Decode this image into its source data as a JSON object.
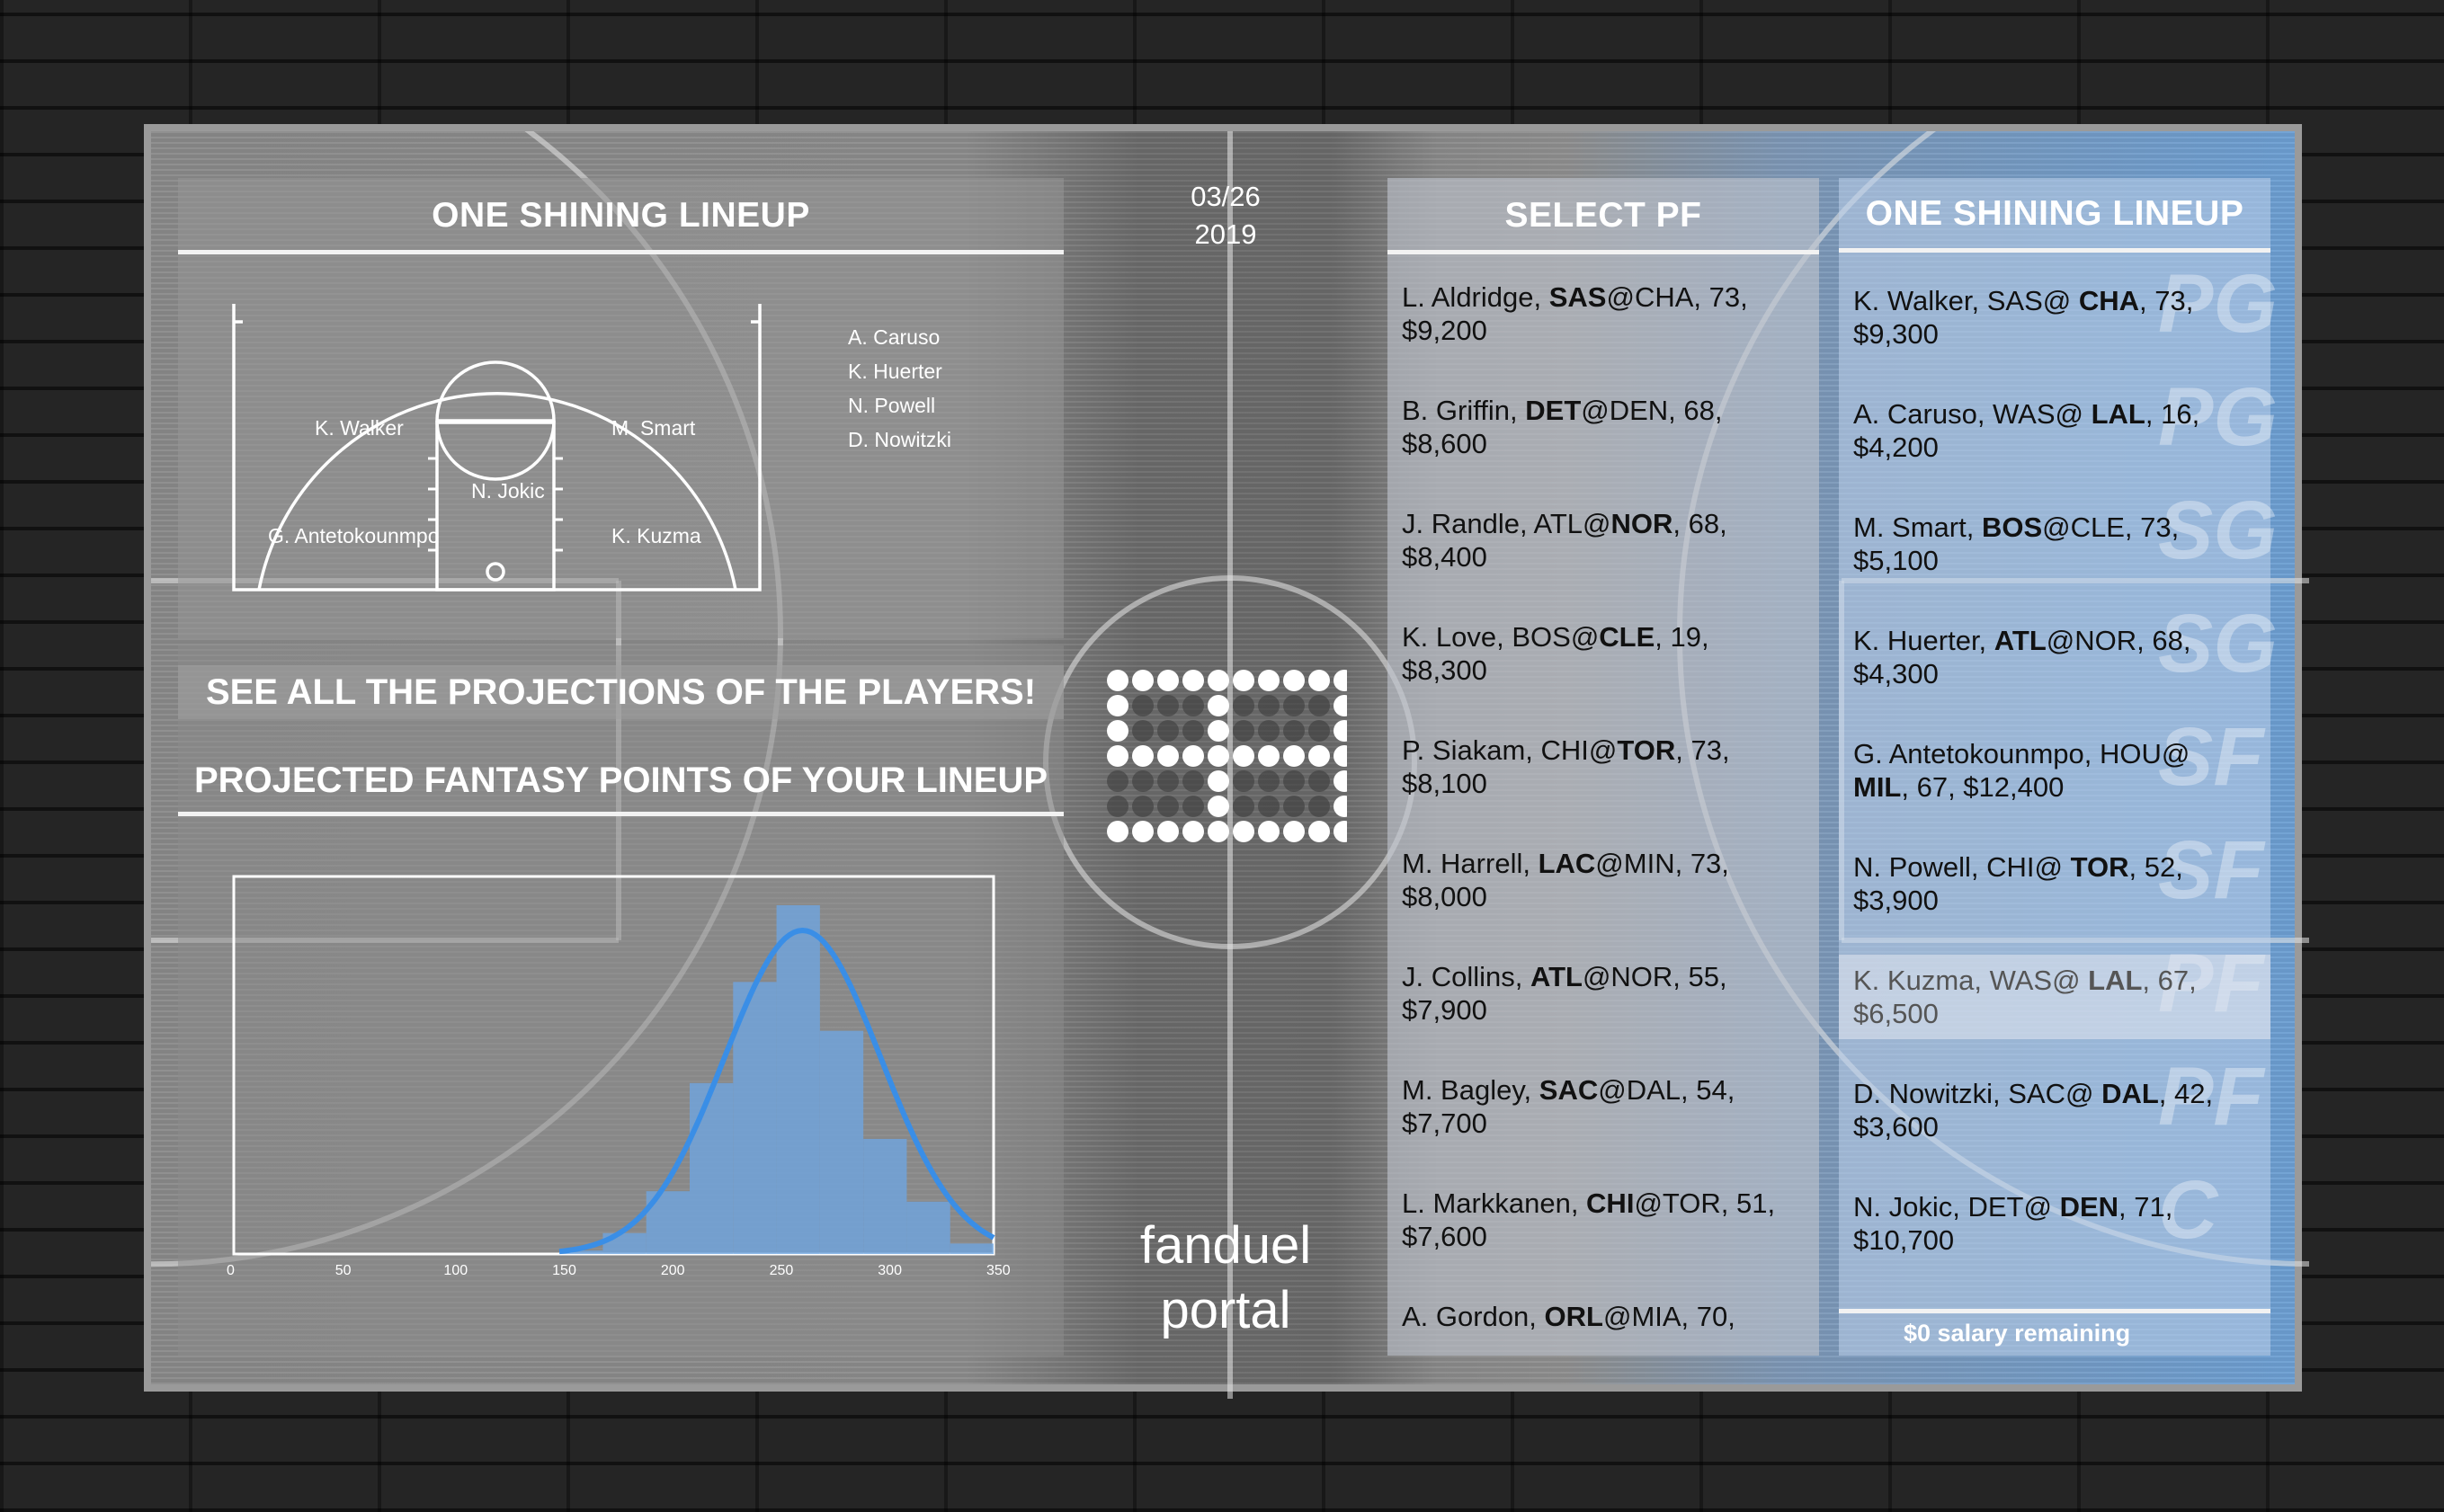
{
  "left_panel": {
    "title": "ONE SHINING LINEUP",
    "bench": [
      "A. Caruso",
      "K. Huerter",
      "N. Powell",
      "D. Nowitzki"
    ],
    "positions": {
      "pg": "K. Walker",
      "sg": "M. Smart",
      "c": "N. Jokic",
      "sf": "G. Antetokounmpo",
      "pf": "K. Kuzma"
    }
  },
  "banners": {
    "projections": "SEE ALL THE PROJECTIONS OF THE PLAYERS!",
    "fantasy": "PROJECTED FANTASY POINTS OF YOUR LINEUP"
  },
  "chart_data": {
    "type": "bar",
    "x_ticks": [
      "0",
      "50",
      "100",
      "150",
      "200",
      "250",
      "300",
      "350"
    ],
    "xlim": [
      0,
      350
    ],
    "bins": [
      {
        "x0": 150,
        "x1": 170,
        "v": 0.01
      },
      {
        "x0": 170,
        "x1": 190,
        "v": 0.06
      },
      {
        "x0": 190,
        "x1": 210,
        "v": 0.18
      },
      {
        "x0": 210,
        "x1": 230,
        "v": 0.49
      },
      {
        "x0": 230,
        "x1": 250,
        "v": 0.78
      },
      {
        "x0": 250,
        "x1": 270,
        "v": 1.0
      },
      {
        "x0": 270,
        "x1": 290,
        "v": 0.64
      },
      {
        "x0": 290,
        "x1": 310,
        "v": 0.33
      },
      {
        "x0": 310,
        "x1": 330,
        "v": 0.15
      },
      {
        "x0": 330,
        "x1": 350,
        "v": 0.03
      }
    ],
    "curve": {
      "mean": 262,
      "sd": 36,
      "peak": 0.9
    }
  },
  "center": {
    "date_line1": "03/26",
    "date_line2": "2019",
    "scoreboard": "93",
    "brand_line1": "fanduel",
    "brand_line2": "portal"
  },
  "select_panel": {
    "title": "SELECT PF",
    "players": [
      {
        "pre": "L. Aldridge, ",
        "team": "SAS",
        "mid": "@CHA",
        "post": ", 73,",
        "line2": "$9,200",
        "team_first": true
      },
      {
        "pre": "B. Griffin, ",
        "team": "DET",
        "mid": "@DEN",
        "post": ", 68,",
        "line2": "$8,600",
        "team_first": true
      },
      {
        "pre": "J. Randle, ATL@",
        "team": "NOR",
        "mid": "",
        "post": ", 68,",
        "line2": "$8,400",
        "team_first": false
      },
      {
        "pre": "K. Love, BOS@",
        "team": "CLE",
        "mid": "",
        "post": ", 19,",
        "line2": "$8,300",
        "team_first": false
      },
      {
        "pre": "P. Siakam, CHI@",
        "team": "TOR",
        "mid": "",
        "post": ", 73,",
        "line2": "$8,100",
        "team_first": false
      },
      {
        "pre": "M. Harrell, ",
        "team": "LAC",
        "mid": "@MIN",
        "post": ", 73,",
        "line2": "$8,000",
        "team_first": true
      },
      {
        "pre": "J. Collins, ",
        "team": "ATL",
        "mid": "@NOR",
        "post": ", 55,",
        "line2": "$7,900",
        "team_first": true
      },
      {
        "pre": "M. Bagley, ",
        "team": "SAC",
        "mid": "@DAL",
        "post": ", 54,",
        "line2": "$7,700",
        "team_first": true
      },
      {
        "pre": "L. Markkanen, ",
        "team": "CHI",
        "mid": "@TOR",
        "post": ", 51,",
        "line2": "$7,600",
        "team_first": true
      },
      {
        "pre": "A. Gordon, ",
        "team": "ORL",
        "mid": "@MIA",
        "post": ", 70,",
        "line2": "",
        "team_first": true
      }
    ]
  },
  "right_panel": {
    "title": "ONE SHINING LINEUP",
    "ghost_labels": [
      "PG",
      "PG",
      "SG",
      "SG",
      "SF",
      "SF",
      "PF",
      "PF",
      "C"
    ],
    "players": [
      {
        "pre": "K. Walker, SAS@ ",
        "team": "CHA",
        "post": ", 73,",
        "line2": "$9,300"
      },
      {
        "pre": "A. Caruso, WAS@ ",
        "team": "LAL",
        "post": ", 16,",
        "line2": "$4,200"
      },
      {
        "pre": "M. Smart, ",
        "team": "BOS",
        "post": "@CLE, 73,",
        "line2": "$5,100"
      },
      {
        "pre": "K. Huerter, ",
        "team": "ATL",
        "post": "@NOR, 68,",
        "line2": "$4,300"
      },
      {
        "pre": "G. Antetokounmpo, HOU@",
        "team": "",
        "post": "",
        "line2_team": "MIL",
        "line2": ", 67, $12,400"
      },
      {
        "pre": "N. Powell, CHI@ ",
        "team": "TOR",
        "post": ", 52,",
        "line2": "$3,900"
      },
      {
        "pre": "K. Kuzma, WAS@ ",
        "team": "LAL",
        "post": ", 67,",
        "line2": "$6,500"
      },
      {
        "pre": "D. Nowitzki, SAC@ ",
        "team": "DAL",
        "post": ", 42,",
        "line2": "$3,600"
      },
      {
        "pre": "N. Jokic, DET@ ",
        "team": "DEN",
        "post": ", 71,",
        "line2": "$10,700"
      }
    ],
    "salary": "$0 salary remaining"
  }
}
